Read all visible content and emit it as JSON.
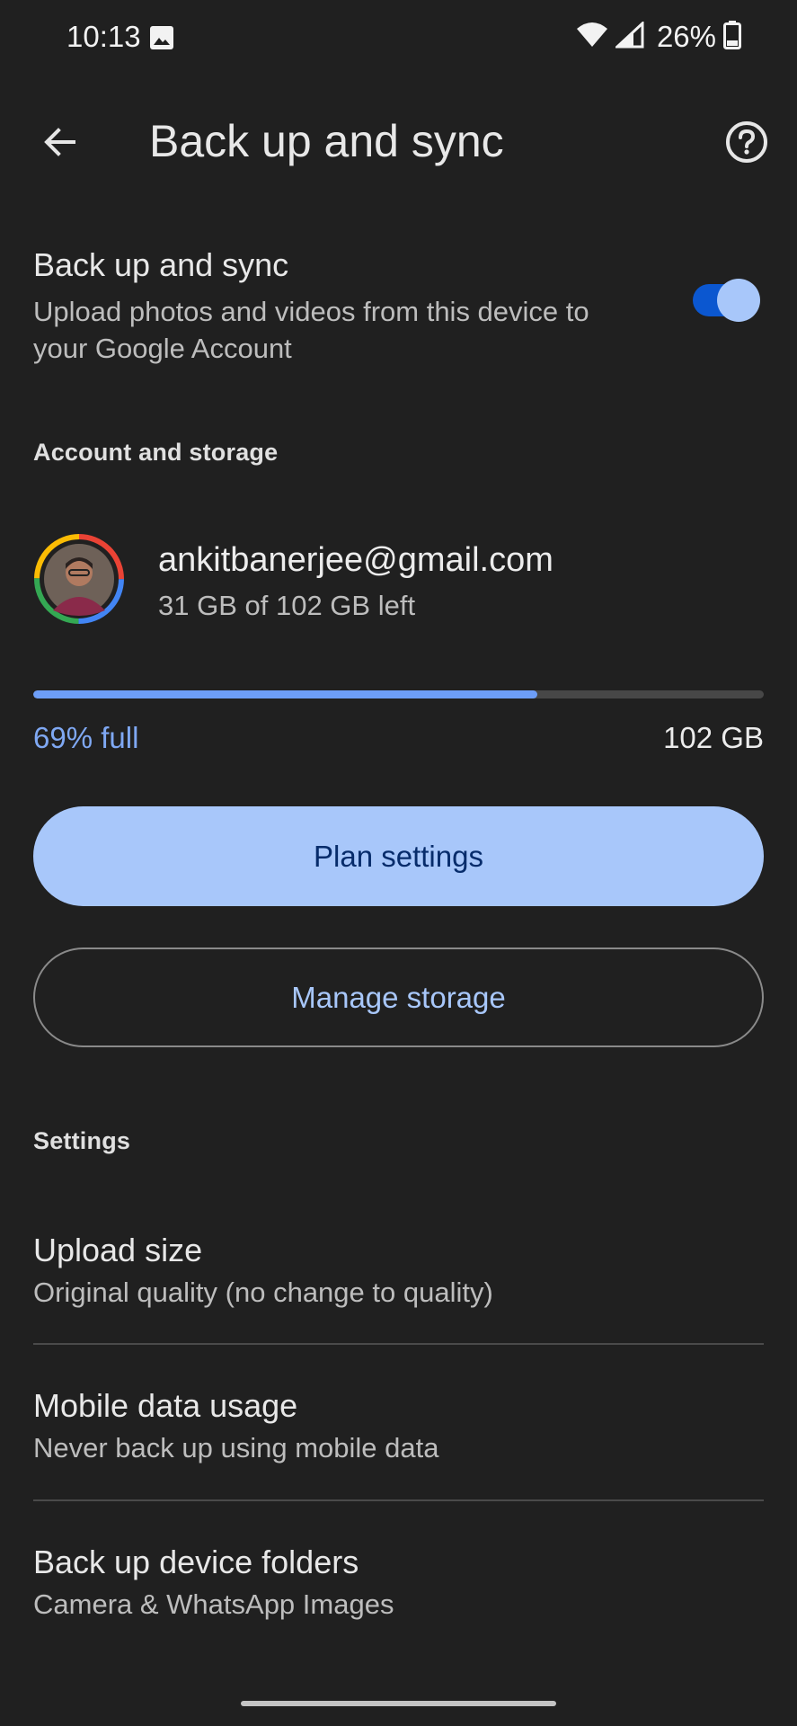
{
  "status_bar": {
    "time": "10:13",
    "battery_percent": "26%",
    "icons": [
      "image-icon",
      "wifi-icon",
      "signal-icon",
      "battery-icon"
    ]
  },
  "app_bar": {
    "title": "Back up and sync",
    "back_icon": "arrow-back-icon",
    "help_icon": "help-icon"
  },
  "backup": {
    "title": "Back up and sync",
    "description": "Upload photos and videos from this device to your Google Account",
    "enabled": true
  },
  "account_section": {
    "header": "Account and storage",
    "email": "ankitbanerjee@gmail.com",
    "storage_left": "31 GB of 102 GB left",
    "usage_fraction": 0.69,
    "percent_label": "69% full",
    "total_label": "102 GB"
  },
  "buttons": {
    "plan_settings": "Plan settings",
    "manage_storage": "Manage storage"
  },
  "settings_section": {
    "header": "Settings",
    "items": [
      {
        "title": "Upload size",
        "subtitle": "Original quality (no change to quality)"
      },
      {
        "title": "Mobile data usage",
        "subtitle": "Never back up using mobile data"
      },
      {
        "title": "Back up device folders",
        "subtitle": "Camera & WhatsApp Images"
      }
    ]
  },
  "colors": {
    "background": "#202020",
    "accent": "#a8c7fa",
    "toggle_track": "#0b57d0",
    "progress_fill": "#6d9ef8"
  }
}
